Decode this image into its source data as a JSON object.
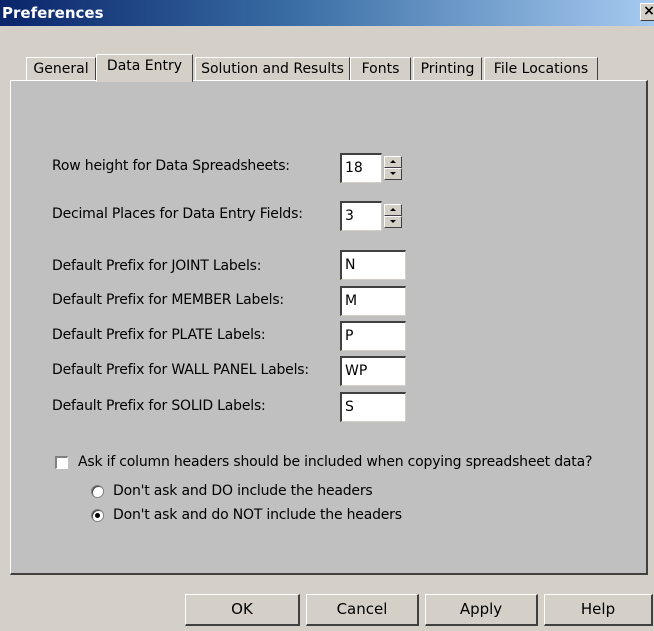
{
  "window": {
    "title": "Preferences",
    "close_glyph": "×"
  },
  "tabs": [
    {
      "label": "General"
    },
    {
      "label": "Data Entry",
      "active": true
    },
    {
      "label": "Solution and Results"
    },
    {
      "label": "Fonts"
    },
    {
      "label": "Printing"
    },
    {
      "label": "File Locations"
    }
  ],
  "fields": {
    "row_height": {
      "label": "Row height for Data Spreadsheets:",
      "value": "18"
    },
    "decimal_places": {
      "label": "Decimal Places for Data Entry Fields:",
      "value": "3"
    },
    "joint_prefix": {
      "label": "Default Prefix for JOINT Labels:",
      "value": "N"
    },
    "member_prefix": {
      "label": "Default Prefix for MEMBER Labels:",
      "value": "M"
    },
    "plate_prefix": {
      "label": "Default Prefix for PLATE Labels:",
      "value": "P"
    },
    "wall_panel_prefix": {
      "label": "Default Prefix for WALL PANEL Labels:",
      "value": "WP"
    },
    "solid_prefix": {
      "label": "Default Prefix for SOLID Labels:",
      "value": "S"
    }
  },
  "copy_headers": {
    "checkbox_label": "Ask if column headers should be included when copying spreadsheet data?",
    "checked": false,
    "options": [
      {
        "label": "Don't ask and DO include the headers",
        "selected": false
      },
      {
        "label": "Don't ask and do NOT include the headers",
        "selected": true
      }
    ]
  },
  "buttons": {
    "ok": "OK",
    "cancel": "Cancel",
    "apply": "Apply",
    "help": "Help"
  },
  "colors": {
    "title_bar_start": "#0a246a",
    "title_bar_end": "#a6caf0",
    "face": "#d4d0c8",
    "panel": "#c0c0c0"
  }
}
